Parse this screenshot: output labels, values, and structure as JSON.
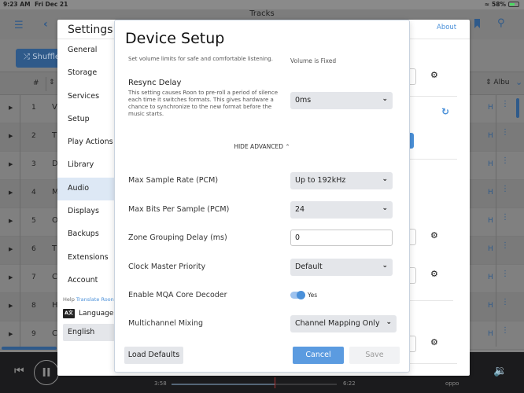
{
  "status_bar": {
    "time": "9:23 AM",
    "date": "Fri Dec 21",
    "wifi_icon": "wifi-icon",
    "battery_percent": "58%",
    "battery_level": 0.58,
    "battery_state": "charging"
  },
  "app_bar": {
    "title": "Tracks",
    "menu_icon": "hamburger-icon",
    "back_icon": "chevron-left-icon",
    "bookmark_icon": "bookmark-icon",
    "search_icon": "search-icon"
  },
  "tracks_view": {
    "shuffle_label": "Shuffle",
    "columns": {
      "number": "#",
      "sort_icon": "sort-icon",
      "album": "Albu"
    },
    "rows": [
      {
        "num": "1",
        "title": "V"
      },
      {
        "num": "2",
        "title": "T"
      },
      {
        "num": "3",
        "title": "D"
      },
      {
        "num": "4",
        "title": "M"
      },
      {
        "num": "5",
        "title": "O"
      },
      {
        "num": "6",
        "title": "T"
      },
      {
        "num": "7",
        "title": "C"
      },
      {
        "num": "8",
        "title": "H"
      },
      {
        "num": "9",
        "title": "C"
      }
    ],
    "row_trailing": "H"
  },
  "player": {
    "elapsed": "3:58",
    "total": "6:22",
    "progress": 0.625,
    "zone": "oppo"
  },
  "settings": {
    "title": "Settings",
    "about": "About",
    "nav": [
      {
        "label": "General"
      },
      {
        "label": "Storage"
      },
      {
        "label": "Services"
      },
      {
        "label": "Setup"
      },
      {
        "label": "Play Actions"
      },
      {
        "label": "Library"
      },
      {
        "label": "Audio",
        "active": true
      },
      {
        "label": "Displays"
      },
      {
        "label": "Backups"
      },
      {
        "label": "Extensions"
      },
      {
        "label": "Account"
      }
    ],
    "help_prefix": "Help",
    "help_link": "Translate Roon",
    "language_label": "Language",
    "language_value": "English"
  },
  "device_setup": {
    "title": "Device Setup",
    "volume_desc_cut": "Set volume limits for safe and comfortable listening.",
    "volume_value": "Volume is Fixed",
    "resync": {
      "label": "Resync Delay",
      "description": "This setting causes Roon to pre-roll a period of silence each time it switches formats. This gives hardware a chance to synchronize to the new format before the music starts.",
      "value": "0ms"
    },
    "hide_advanced": "HIDE ADVANCED",
    "max_sample_rate": {
      "label": "Max Sample Rate (PCM)",
      "value": "Up to 192kHz"
    },
    "max_bits": {
      "label": "Max Bits Per Sample (PCM)",
      "value": "24"
    },
    "zone_grouping": {
      "label": "Zone Grouping Delay (ms)",
      "value": "0"
    },
    "clock_master": {
      "label": "Clock Master Priority",
      "value": "Default"
    },
    "mqa": {
      "label": "Enable MQA Core Decoder",
      "value": "Yes",
      "enabled": true
    },
    "multichannel": {
      "label": "Multichannel Mixing",
      "value": "Channel Mapping Only"
    },
    "buttons": {
      "load_defaults": "Load Defaults",
      "cancel": "Cancel",
      "save": "Save"
    }
  }
}
